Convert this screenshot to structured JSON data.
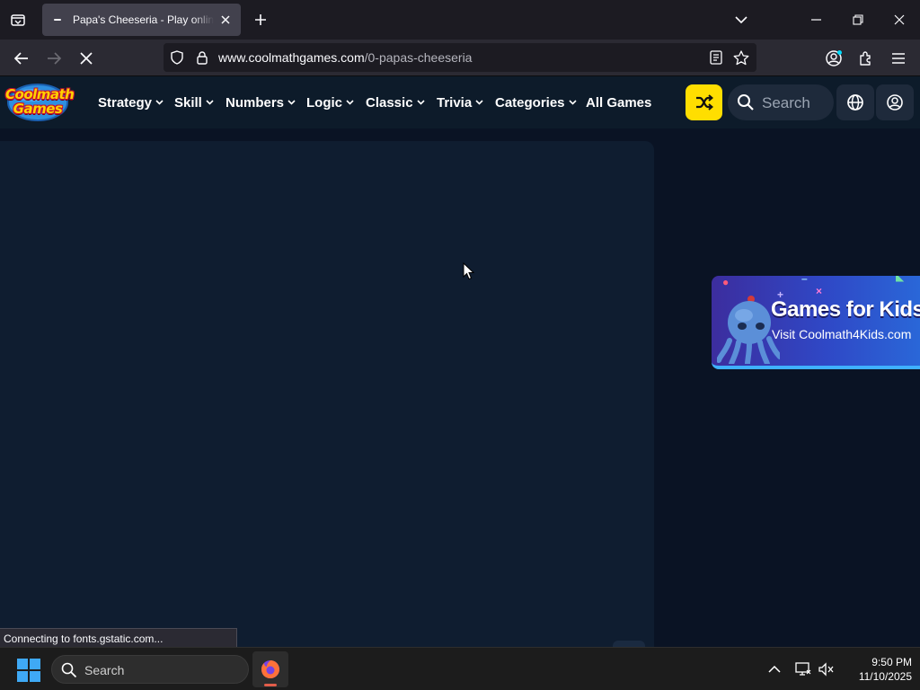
{
  "browser": {
    "tab": {
      "title": "Papa's Cheeseria - Play online at Coolmath Games"
    },
    "url": {
      "host": "www.coolmathgames.com",
      "path": "/0-papas-cheeseria"
    },
    "status_text": "Connecting to fonts.gstatic.com..."
  },
  "site": {
    "logo": {
      "line1": "Coolmath",
      "line2": "Games"
    },
    "menu": [
      {
        "label": "Strategy",
        "has_dropdown": true
      },
      {
        "label": "Skill",
        "has_dropdown": true
      },
      {
        "label": "Numbers",
        "has_dropdown": true
      },
      {
        "label": "Logic",
        "has_dropdown": true
      },
      {
        "label": "Classic",
        "has_dropdown": true
      },
      {
        "label": "Trivia",
        "has_dropdown": true
      },
      {
        "label": "Categories",
        "has_dropdown": true
      },
      {
        "label": "All Games",
        "has_dropdown": false
      }
    ],
    "search_placeholder": "Search",
    "promo": {
      "heading": "Games for Kids",
      "subtext": "Visit Coolmath4Kids.com"
    }
  },
  "taskbar": {
    "search_label": "Search",
    "time": "9:50 PM",
    "date": "11/10/2025"
  },
  "colors": {
    "accent_yellow": "#ffde00",
    "header_bg": "#0d1b2a",
    "game_panel_bg": "#0f1d30",
    "promo_start": "#3c2d9e",
    "promo_end": "#2a67d8"
  },
  "icons": {
    "tab_list": "tab-list-icon",
    "reload_stop": "stop-loading-icon",
    "shuffle": "shuffle-icon",
    "language": "globe-icon",
    "account": "user-icon"
  }
}
